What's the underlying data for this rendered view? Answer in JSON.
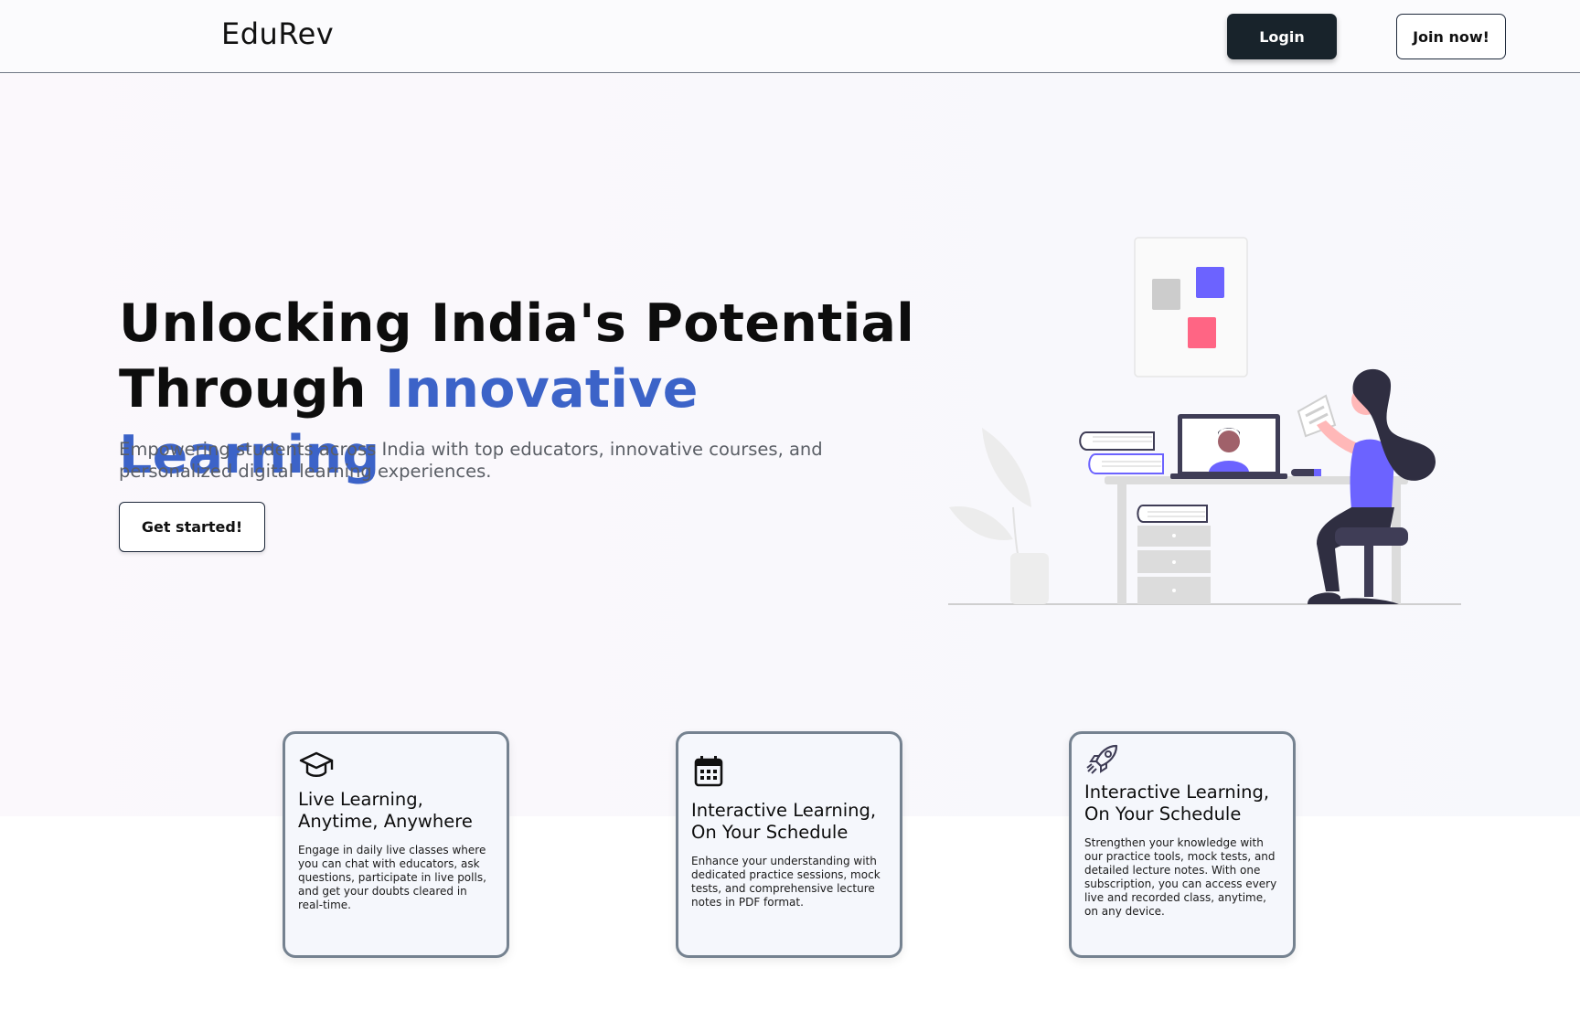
{
  "header": {
    "logo": "EduRev",
    "login_label": "Login",
    "join_label": "Join now!"
  },
  "hero": {
    "title_line1": "Unlocking India's Potential",
    "title_line2_plain": "Through ",
    "title_line2_accent": "Innovative Learning",
    "subtitle": "Empowering students across India with top educators, innovative courses, and personalized digital learning experiences.",
    "cta_label": "Get started!"
  },
  "features": [
    {
      "icon": "graduation-cap-icon",
      "title": "Live Learning, Anytime, Anywhere",
      "body": "Engage in daily live classes where you can chat with educators, ask questions, participate in live polls, and get your doubts cleared in real-time."
    },
    {
      "icon": "calendar-icon",
      "title": "Interactive Learning, On Your Schedule",
      "body": "Enhance your understanding with dedicated practice sessions, mock tests, and comprehensive lecture notes in PDF format."
    },
    {
      "icon": "rocket-icon",
      "title": "Interactive Learning, On Your Schedule",
      "body": "Strengthen your knowledge with our practice tools, mock tests, and detailed lecture notes. With one subscription, you can access every live and recorded class, anytime, on any device."
    }
  ],
  "colors": {
    "accent": "#3c63c8",
    "dark_button": "#18232b",
    "illustration_purple": "#6c63ff",
    "illustration_pink": "#ff6584"
  }
}
